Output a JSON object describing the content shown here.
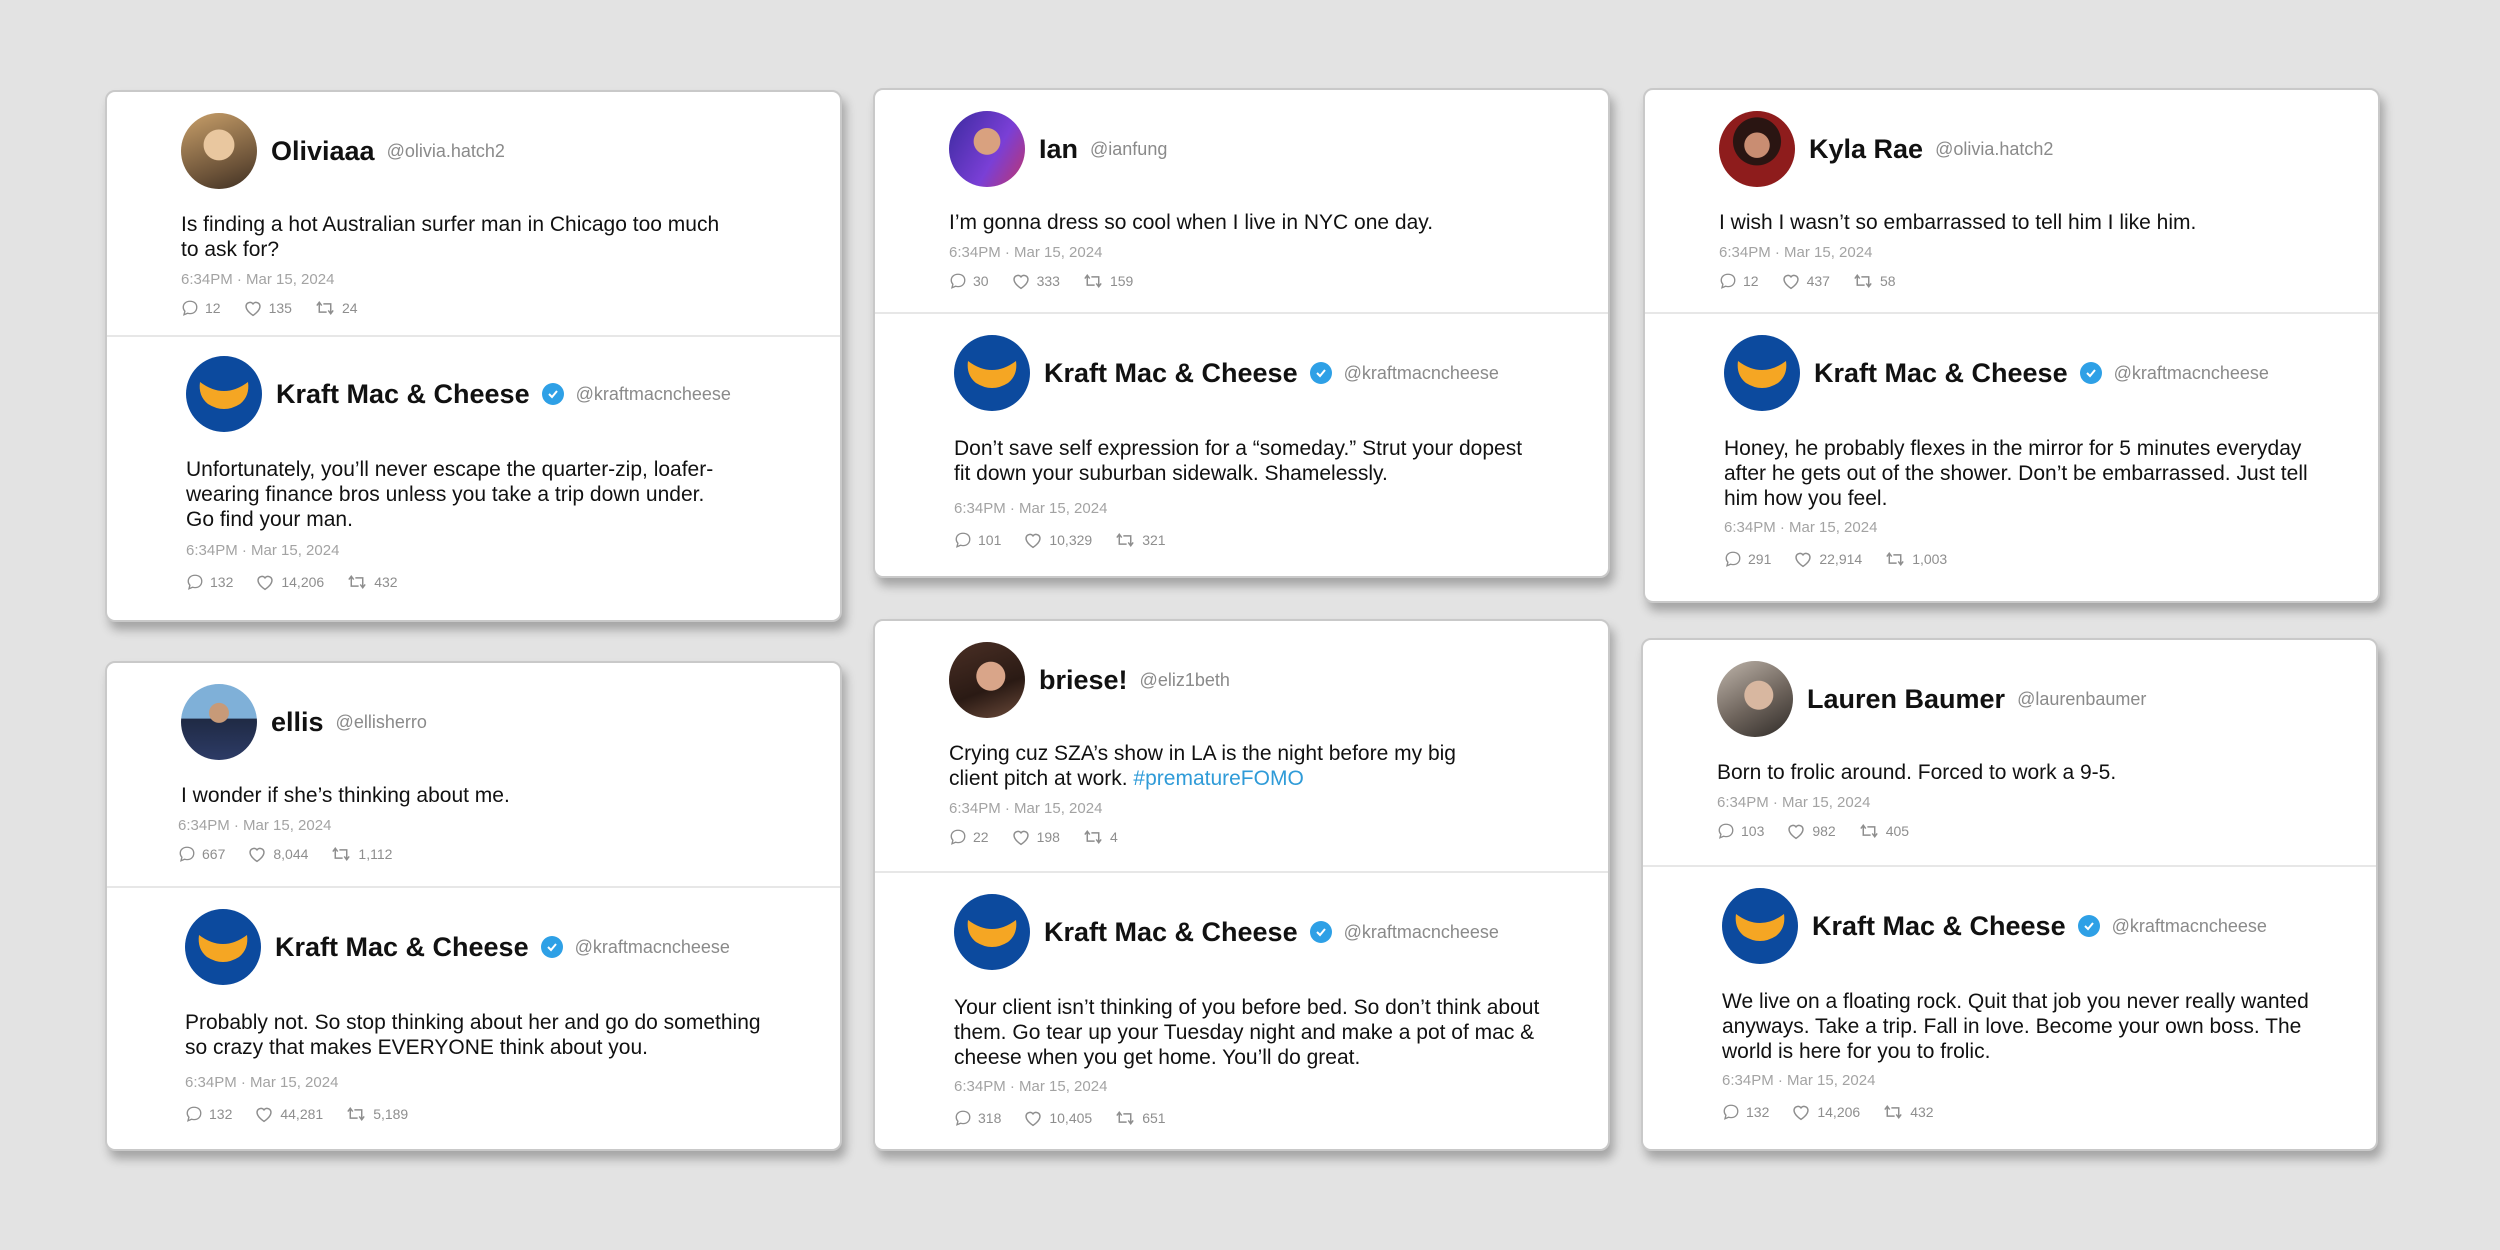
{
  "brand": {
    "name": "Kraft Mac & Cheese",
    "handle": "@kraftmacncheese",
    "avatar_color": "#0c4a9e",
    "smile_color": "#f5a623",
    "verified_color": "#2ea0e6"
  },
  "cards": [
    {
      "post": {
        "name": "Oliviaaa",
        "handle": "@olivia.hatch2",
        "text": "Is finding a hot Australian surfer man in Chicago too much to ask for?",
        "time": "6:34PM  ·  Mar 15, 2024",
        "replies": "12",
        "likes": "135",
        "reposts": "24"
      },
      "reply": {
        "text": "Unfortunately, you’ll never escape the quarter-zip, loafer-wearing finance bros unless you take a trip down under. Go find your man.",
        "time": "6:34PM  ·  Mar 15, 2024",
        "replies": "132",
        "likes": "14,206",
        "reposts": "432"
      }
    },
    {
      "post": {
        "name": "Ian",
        "handle": "@ianfung",
        "text": "I’m gonna dress so cool when I live in NYC one day.",
        "time": "6:34PM  ·  Mar 15, 2024",
        "replies": "30",
        "likes": "333",
        "reposts": "159"
      },
      "reply": {
        "text": "Don’t save self expression for a “someday.” Strut your dopest fit down your suburban sidewalk. Shamelessly.",
        "time": "6:34PM  ·  Mar 15, 2024",
        "replies": "101",
        "likes": "10,329",
        "reposts": "321"
      }
    },
    {
      "post": {
        "name": "Kyla Rae",
        "handle": "@olivia.hatch2",
        "text": "I wish I wasn’t so embarrassed to tell him I like him.",
        "time": "6:34PM  ·  Mar 15, 2024",
        "replies": "12",
        "likes": "437",
        "reposts": "58"
      },
      "reply": {
        "text": "Honey, he probably flexes in the mirror for 5 minutes everyday after he gets out of the shower. Don’t be embarrassed. Just tell him how you feel.",
        "time": "6:34PM  ·  Mar 15, 2024",
        "replies": "291",
        "likes": "22,914",
        "reposts": "1,003"
      }
    },
    {
      "post": {
        "name": "ellis",
        "handle": "@ellisherro",
        "text": "I wonder if she’s thinking about me.",
        "time": "6:34PM  ·  Mar 15, 2024",
        "replies": "667",
        "likes": "8,044",
        "reposts": "1,112"
      },
      "reply": {
        "text": "Probably not. So stop thinking about her and go do something so crazy that makes EVERYONE think about you.",
        "time": "6:34PM  ·  Mar 15, 2024",
        "replies": "132",
        "likes": "44,281",
        "reposts": "5,189"
      }
    },
    {
      "post": {
        "name": "briese!",
        "handle": "@eliz1beth",
        "text": "Crying cuz SZA’s show in LA is the night before my big client pitch at work.",
        "hashtag": "#prematureFOMO",
        "time": "6:34PM  ·  Mar 15, 2024",
        "replies": "22",
        "likes": "198",
        "reposts": "4"
      },
      "reply": {
        "text": "Your client isn’t thinking of you before bed. So don’t think about them. Go tear up your Tuesday night and make a pot of mac & cheese when you get home. You’ll do great.",
        "time": "6:34PM  ·  Mar 15, 2024",
        "replies": "318",
        "likes": "10,405",
        "reposts": "651"
      }
    },
    {
      "post": {
        "name": "Lauren Baumer",
        "handle": "@laurenbaumer",
        "text": "Born to frolic around. Forced to work a 9-5.",
        "time": "6:34PM  ·  Mar 15, 2024",
        "replies": "103",
        "likes": "982",
        "reposts": "405"
      },
      "reply": {
        "text": "We live on a floating rock. Quit that job you never really wanted anyways. Take a trip. Fall in love. Become your own boss. The world is here for you to frolic.",
        "time": "6:34PM  ·  Mar 15, 2024",
        "replies": "132",
        "likes": "14,206",
        "reposts": "432"
      }
    }
  ]
}
